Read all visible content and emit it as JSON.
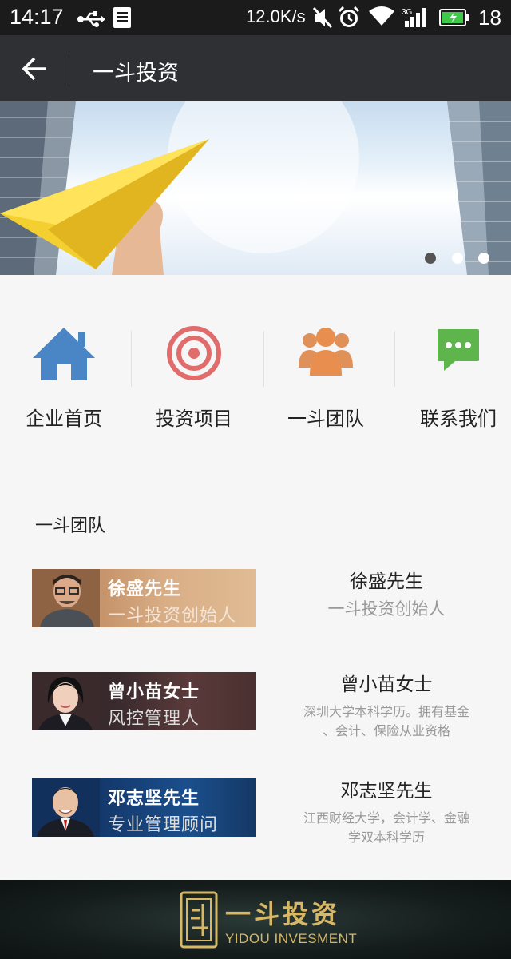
{
  "status_bar": {
    "time": "14:17",
    "net_speed": "12.0K/s",
    "network_type": "3G",
    "battery": "18"
  },
  "header": {
    "title": "一斗投资"
  },
  "banner": {
    "slide_count": 3,
    "active_index": 0
  },
  "nav": {
    "items": [
      {
        "label": "企业首页",
        "icon": "home-icon",
        "color": "#4a86c6"
      },
      {
        "label": "投资项目",
        "icon": "target-icon",
        "color": "#e06c6c"
      },
      {
        "label": "一斗团队",
        "icon": "team-icon",
        "color": "#e0915a"
      },
      {
        "label": "联系我们",
        "icon": "chat-icon",
        "color": "#5db54c"
      }
    ]
  },
  "team": {
    "section_title": "一斗团队",
    "members": [
      {
        "photo_name": "徐盛先生",
        "photo_role": "一斗投资创始人",
        "name": "徐盛先生",
        "desc": "一斗投资创始人"
      },
      {
        "photo_name": "曾小苗女士",
        "photo_role": "风控管理人",
        "name": "曾小苗女士",
        "desc_line1": "深圳大学本科学历。拥有基金",
        "desc_line2": "、会计、保险从业资格"
      },
      {
        "photo_name": "邓志坚先生",
        "photo_role": "专业管理顾问",
        "name": "邓志坚先生",
        "desc_line1": "江西财经大学，会计学、金融",
        "desc_line2": "学双本科学历"
      }
    ]
  },
  "footer": {
    "logo_cn": "一斗投资",
    "logo_en": "YIDOU INVESMENT"
  }
}
